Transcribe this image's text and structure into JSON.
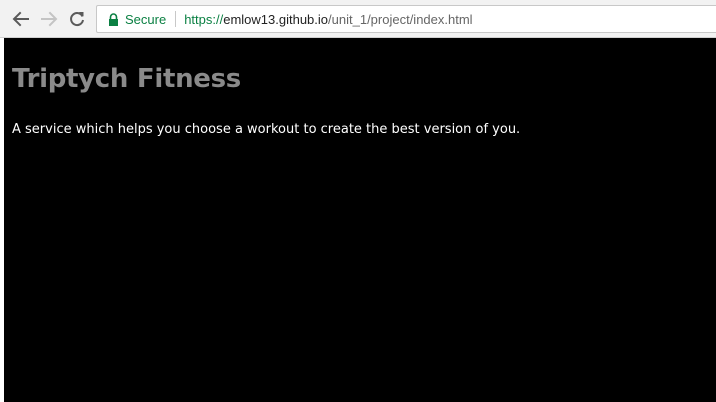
{
  "browser": {
    "secure_label": "Secure",
    "url_scheme": "https://",
    "url_host": "emlow13.github.io",
    "url_path": "/unit_1/project/index.html",
    "icons": {
      "back": "arrow-left-icon",
      "forward": "arrow-right-icon",
      "reload": "reload-icon",
      "lock": "lock-icon"
    },
    "colors": {
      "secure": "#0b8043"
    }
  },
  "page": {
    "title": "Triptych Fitness",
    "tagline": "A service which helps you choose a workout to create the best version of you.",
    "colors": {
      "background": "#000000",
      "title": "#8a8a8a",
      "text": "#ffffff"
    }
  }
}
